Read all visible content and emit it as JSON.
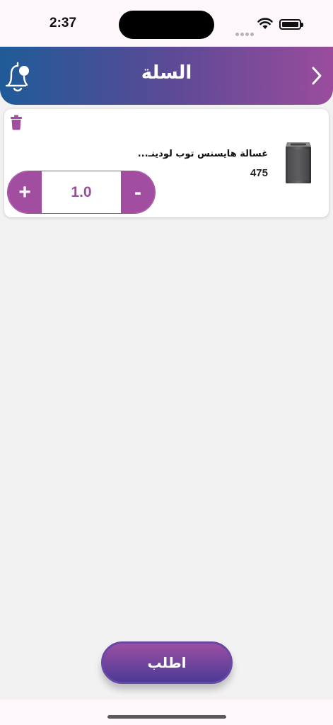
{
  "status_bar": {
    "time": "2:37"
  },
  "header": {
    "title": "السلة"
  },
  "cart": {
    "items": [
      {
        "name": "غسالة هايسنس توب لودينـ...",
        "price": "475",
        "quantity": "1.0"
      }
    ],
    "increment_label": "+",
    "decrement_label": "-"
  },
  "order_button": {
    "label": "اطلب"
  },
  "colors": {
    "accent": "#a24ea0",
    "header_start": "#1f5b98",
    "header_end": "#9a4c9c"
  },
  "icons": [
    "wifi-icon",
    "battery-icon",
    "bell-icon",
    "chevron-right-icon",
    "trash-icon",
    "washing-machine-image"
  ]
}
